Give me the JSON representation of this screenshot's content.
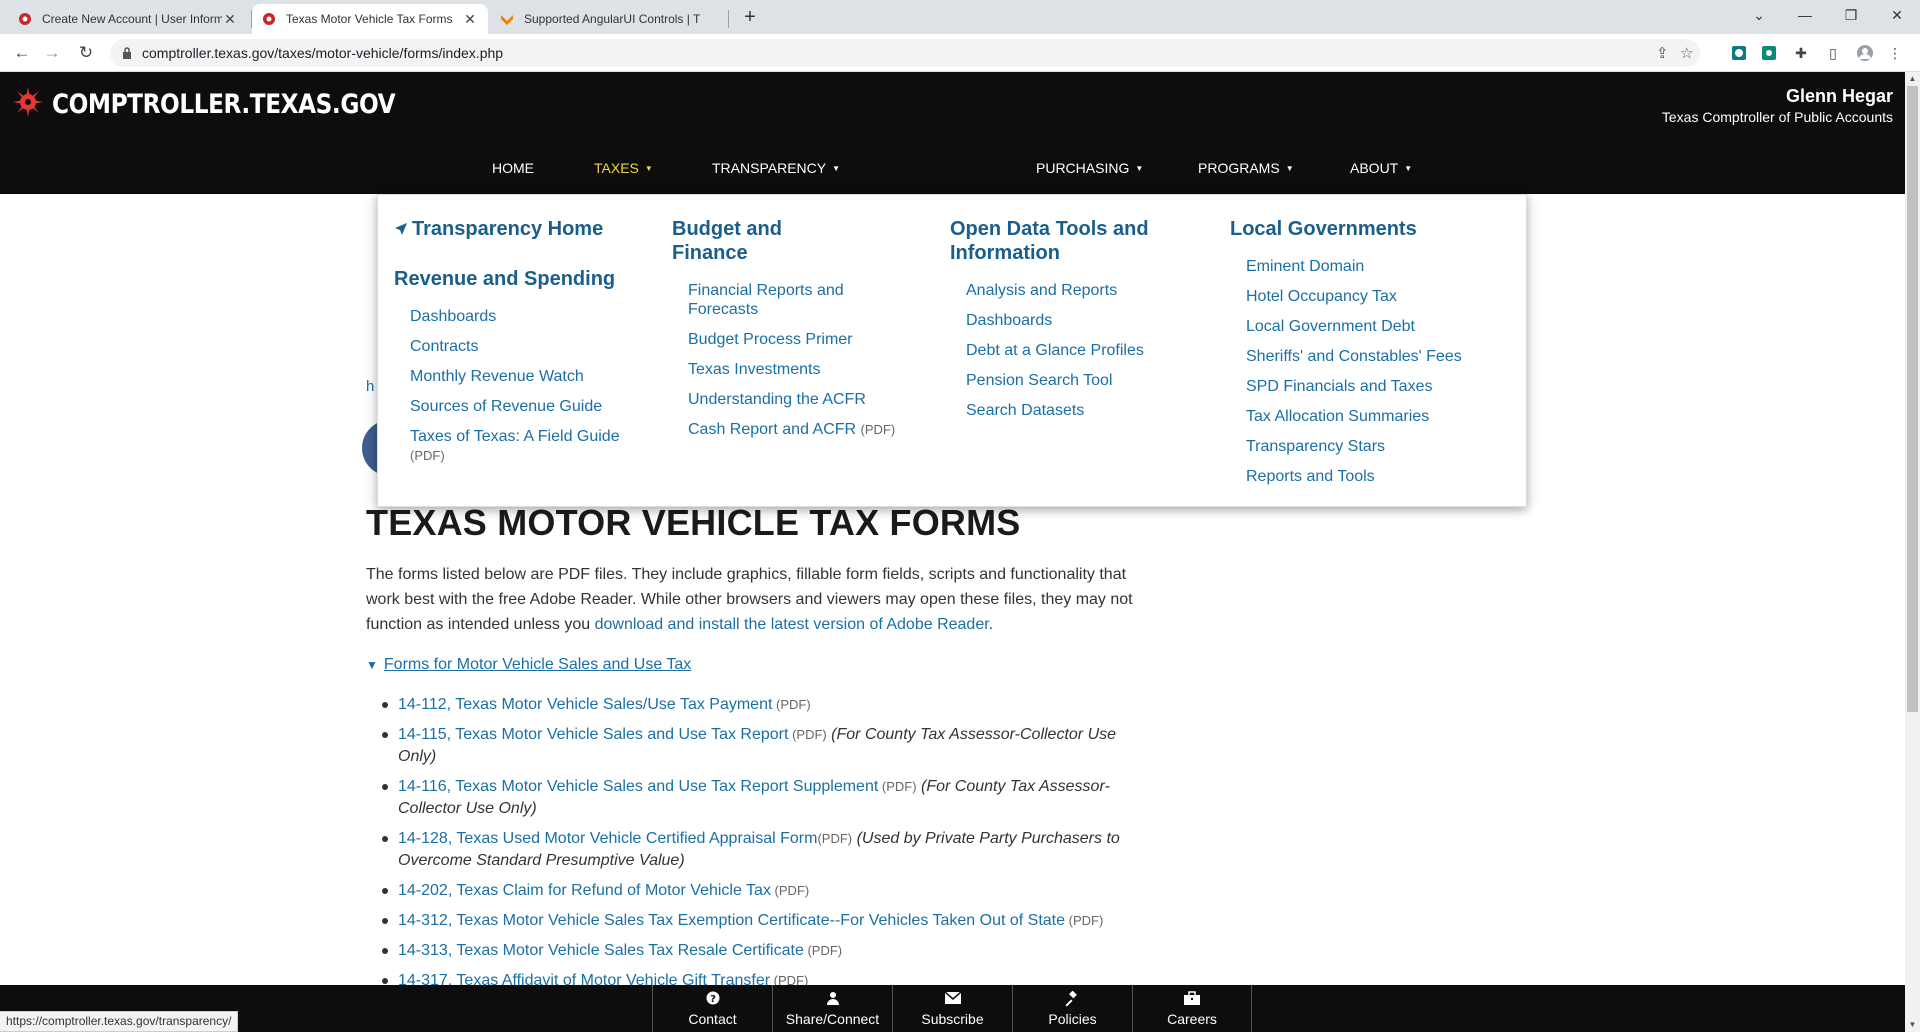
{
  "browser": {
    "tabs": [
      {
        "title": "Create New Account | User Inform"
      },
      {
        "title": "Texas Motor Vehicle Tax Forms"
      },
      {
        "title": "Supported AngularUI Controls | T"
      }
    ],
    "url": "comptroller.texas.gov/taxes/motor-vehicle/forms/index.php",
    "status_url": "https://comptroller.texas.gov/transparency/"
  },
  "header": {
    "logo_text": "COMPTROLLER.TEXAS.GOV",
    "official_name": "Glenn Hegar",
    "official_title": "Texas Comptroller of Public Accounts",
    "nav": {
      "home": "HOME",
      "taxes": "TAXES",
      "transparency": "TRANSPARENCY",
      "purchasing": "PURCHASING",
      "programs": "PROGRAMS",
      "about": "ABOUT"
    }
  },
  "dropdown": {
    "col1": {
      "home_heading": "Transparency Home",
      "heading": "Revenue and Spending",
      "items": [
        "Dashboards",
        "Contracts",
        "Monthly Revenue Watch",
        "Sources of Revenue Guide",
        "Taxes of Texas: A Field Guide"
      ],
      "item5_pdf": "(PDF)"
    },
    "col2": {
      "heading": "Budget and Finance",
      "items": [
        "Financial Reports and Forecasts",
        "Budget Process Primer",
        "Texas Investments",
        "Understanding the ACFR",
        "Cash Report and ACFR"
      ],
      "item5_pdf": "(PDF)"
    },
    "col3": {
      "heading": "Open Data Tools and Information",
      "items": [
        "Analysis and Reports",
        "Dashboards",
        "Debt at a Glance Profiles",
        "Pension Search Tool",
        "Search Datasets"
      ]
    },
    "col4": {
      "heading": "Local Governments",
      "items": [
        "Eminent Domain",
        "Hotel Occupancy Tax",
        "Local Government Debt",
        "Sheriffs' and Constables' Fees",
        "SPD Financials and Taxes",
        "Tax Allocation Summaries",
        "Transparency Stars",
        "Reports and Tools"
      ]
    }
  },
  "page": {
    "breadcrumb_fragment": "h",
    "title": "TEXAS MOTOR VEHICLE TAX FORMS",
    "intro_text": "The forms listed below are PDF files. They include graphics, fillable form fields, scripts and functionality that work best with the free Adobe Reader. While other browsers and viewers may open these files, they may not function as intended unless you ",
    "intro_link": "download and install the latest version of Adobe Reader",
    "intro_end": ".",
    "section_toggle": "Forms for Motor Vehicle Sales and Use Tax",
    "forms": [
      {
        "link": "14-112, Texas Motor Vehicle Sales/Use Tax Payment",
        "pdf": " (PDF)",
        "note": ""
      },
      {
        "link": "14-115, Texas Motor Vehicle Sales and Use Tax Report",
        "pdf": " (PDF)",
        "note": " (For County Tax Assessor-Collector Use Only)"
      },
      {
        "link": "14-116, Texas Motor Vehicle Sales and Use Tax Report Supplement",
        "pdf": " (PDF)",
        "note": " (For County Tax Assessor-Collector Use Only)"
      },
      {
        "link": "14-128, Texas Used Motor Vehicle Certified Appraisal Form",
        "pdf": "(PDF)",
        "note": " (Used by Private Party Purchasers to Overcome Standard Presumptive Value)"
      },
      {
        "link": "14-202, Texas Claim for Refund of Motor Vehicle Tax",
        "pdf": " (PDF)",
        "note": ""
      },
      {
        "link": "14-312, Texas Motor Vehicle Sales Tax Exemption Certificate--For Vehicles Taken Out of State",
        "pdf": " (PDF)",
        "note": ""
      },
      {
        "link": "14-313, Texas Motor Vehicle Sales Tax Resale Certificate",
        "pdf": " (PDF)",
        "note": ""
      },
      {
        "link": "14-317, Texas Affidavit of Motor Vehicle Gift Transfer",
        "pdf": " (PDF)",
        "note": ""
      }
    ]
  },
  "footer": {
    "contact": "Contact",
    "share": "Share/Connect",
    "subscribe": "Subscribe",
    "policies": "Policies",
    "careers": "Careers"
  }
}
